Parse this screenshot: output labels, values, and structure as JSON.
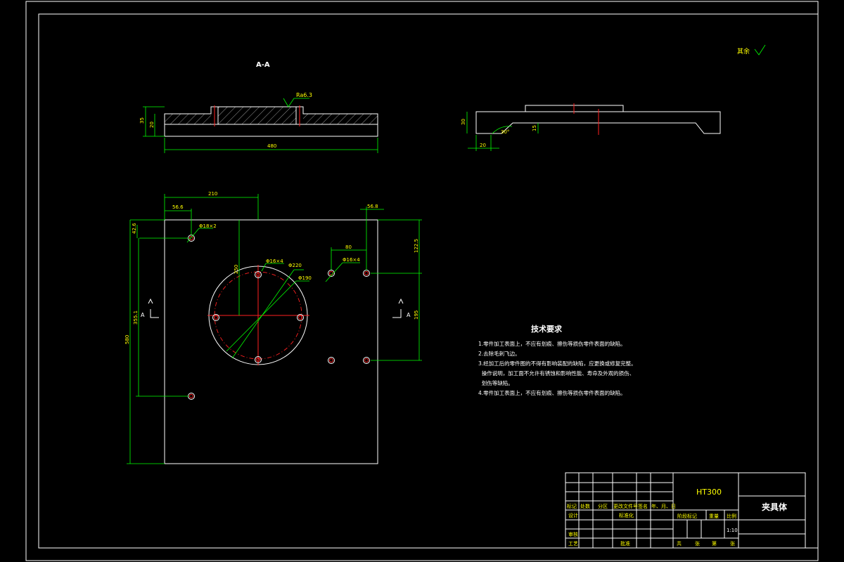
{
  "section_label": "A-A",
  "roughness_note": "其余",
  "roughness_symbol": "Ra6.3",
  "dimensions": {
    "side_height_total": "35",
    "side_height_base": "20",
    "side_width": "480",
    "right_height": "30",
    "right_depth": "15",
    "right_angle": "30°",
    "right_width": "20",
    "top_210": "210",
    "top_56_6": "56.6",
    "top_56_8": "56.8",
    "left_42_6": "42.6",
    "hole_small_left": "Φ18×2",
    "center_250": "250",
    "center_80": "80",
    "hole_small_4": "Φ16×4",
    "hole_4": "Φ16×4",
    "bore_220": "Φ220",
    "bore_190": "Φ190",
    "right_122_5": "122.5",
    "right_195": "195",
    "left_355_1": "355.1",
    "left_580": "580",
    "section_mark_left": "A",
    "section_mark_right": "A"
  },
  "tech_title": "技术要求",
  "tech_lines": [
    "1.零件加工表面上，不应有划痕、擦伤等损伤零件表面的缺陷。",
    "2.去除毛刺飞边。",
    "3.经加工后的零件图的不得有影响装配的缺陷，应更换或修复完整。",
    "  操作说明，加工面不允许有锈蚀和影响性能、寿命及外观的损伤、",
    "  划伤等缺陷。",
    "4.零件加工表面上，不应有划痕、擦伤等损伤零件表面的缺陷。"
  ],
  "title_block": {
    "material": "HT300",
    "part_name": "夹具体",
    "scale_label": "比例",
    "scale_value": "1:10",
    "weight_label": "重量",
    "stage_label": "阶段标记",
    "row_labels": [
      "标记",
      "处数",
      "分区",
      "更改文件号",
      "签名",
      "年、月、日"
    ],
    "design": "设计",
    "standard": "标准化",
    "review": "审核",
    "process": "工艺",
    "approve": "批准",
    "sheet_info": [
      "共",
      "张",
      "第",
      "张"
    ]
  }
}
